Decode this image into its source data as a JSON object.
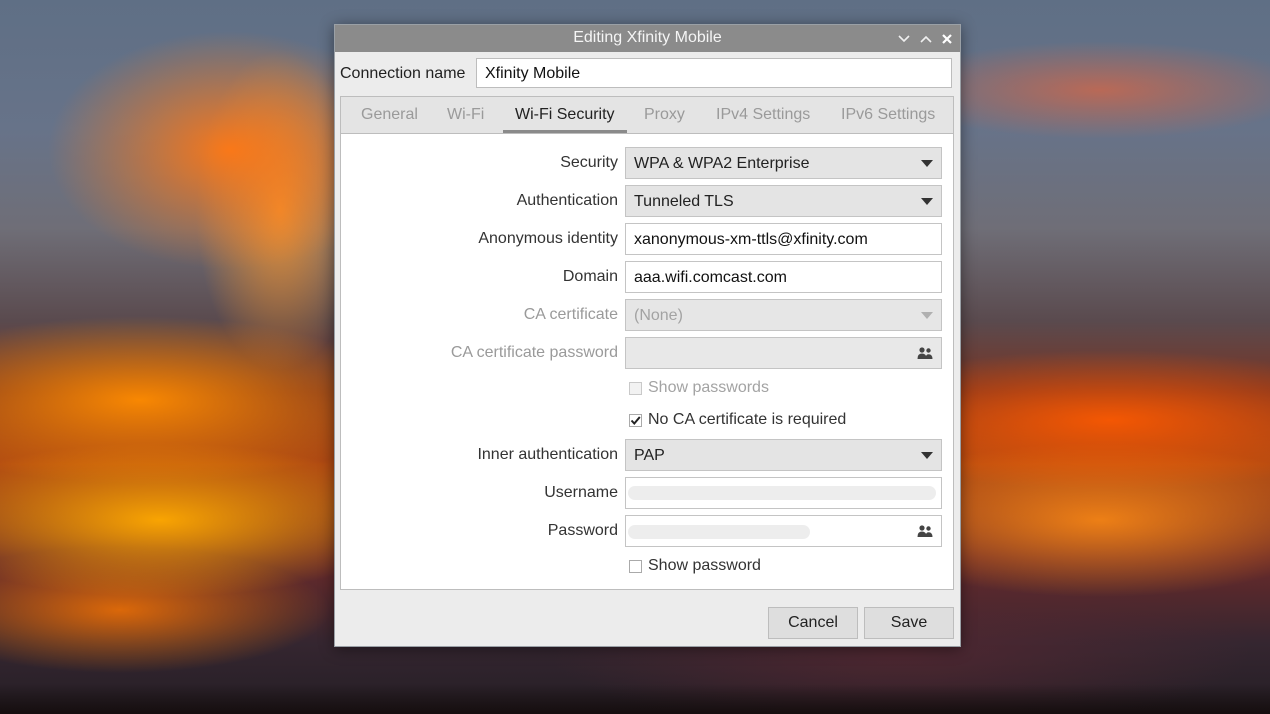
{
  "window": {
    "title": "Editing Xfinity Mobile"
  },
  "connection": {
    "label": "Connection name",
    "value": "Xfinity Mobile"
  },
  "tabs": [
    {
      "label": "General",
      "active": false
    },
    {
      "label": "Wi-Fi",
      "active": false
    },
    {
      "label": "Wi-Fi Security",
      "active": true
    },
    {
      "label": "Proxy",
      "active": false
    },
    {
      "label": "IPv4 Settings",
      "active": false
    },
    {
      "label": "IPv6 Settings",
      "active": false
    }
  ],
  "security": {
    "security_label": "Security",
    "security_value": "WPA & WPA2 Enterprise",
    "auth_label": "Authentication",
    "auth_value": "Tunneled TLS",
    "anon_label": "Anonymous identity",
    "anon_value": "xanonymous-xm-ttls@xfinity.com",
    "domain_label": "Domain",
    "domain_value": "aaa.wifi.comcast.com",
    "ca_label": "CA certificate",
    "ca_value": "(None)",
    "ca_pw_label": "CA certificate password",
    "ca_pw_value": "",
    "show_passwords_label": "Show passwords",
    "show_passwords_checked": false,
    "no_ca_label": "No CA certificate is required",
    "no_ca_checked": true,
    "inner_label": "Inner authentication",
    "inner_value": "PAP",
    "username_label": "Username",
    "password_label": "Password",
    "show_password_label": "Show password",
    "show_password_checked": false
  },
  "buttons": {
    "cancel": "Cancel",
    "save": "Save"
  },
  "colors": {
    "titlebar": "#8b8b8b",
    "window_bg": "#ececec",
    "active_tab_underline": "#8a8a8a"
  }
}
